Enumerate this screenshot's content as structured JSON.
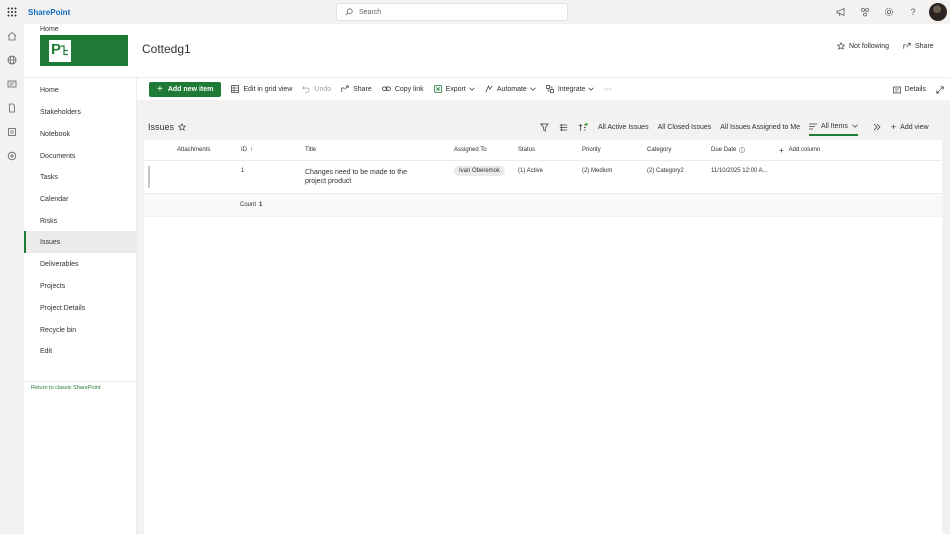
{
  "suite": {
    "brand": "SharePoint",
    "search_placeholder": "Search"
  },
  "header": {
    "breadcrumb": "Home",
    "site_title": "Cottedg1",
    "follow_label": "Not following",
    "share_label": "Share"
  },
  "nav": {
    "items": [
      "Home",
      "Stakeholders",
      "Notebook",
      "Documents",
      "Tasks",
      "Calendar",
      "Risks",
      "Issues",
      "Deliverables",
      "Projects",
      "Project Details",
      "Recycle bin",
      "Edit"
    ],
    "active": "Issues",
    "classic_link": "Return to classic SharePoint"
  },
  "toolbar": {
    "add_new": "Add new item",
    "edit_grid": "Edit in grid view",
    "undo": "Undo",
    "share": "Share",
    "copy_link": "Copy link",
    "export": "Export",
    "automate": "Automate",
    "integrate": "Integrate",
    "more": "···",
    "details": "Details"
  },
  "list": {
    "title": "Issues",
    "views": [
      "All Active Issues",
      "All Closed Issues",
      "All Issues Assigned to Me"
    ],
    "selected_view": "All Items",
    "add_view": "Add view",
    "columns": {
      "attachments": "Attachments",
      "id": "ID",
      "id_sort": "↑",
      "title": "Title",
      "assigned_to": "Assigned To",
      "status": "Status",
      "priority": "Priority",
      "category": "Category",
      "due_date": "Due Date",
      "add_column": "Add column"
    },
    "rows": [
      {
        "id": "1",
        "title": "Changes need to be made to the project product",
        "assigned_to": "Ivan Oberemok",
        "status": "(1) Active",
        "priority": "(2) Medium",
        "category": "(2) Category2",
        "due_date": "11/10/2025 12:00 A..."
      }
    ],
    "count_label": "Count",
    "count_value": "1"
  },
  "colors": {
    "accent": "#1e7a35",
    "brand_blue": "#0f6cbd"
  }
}
